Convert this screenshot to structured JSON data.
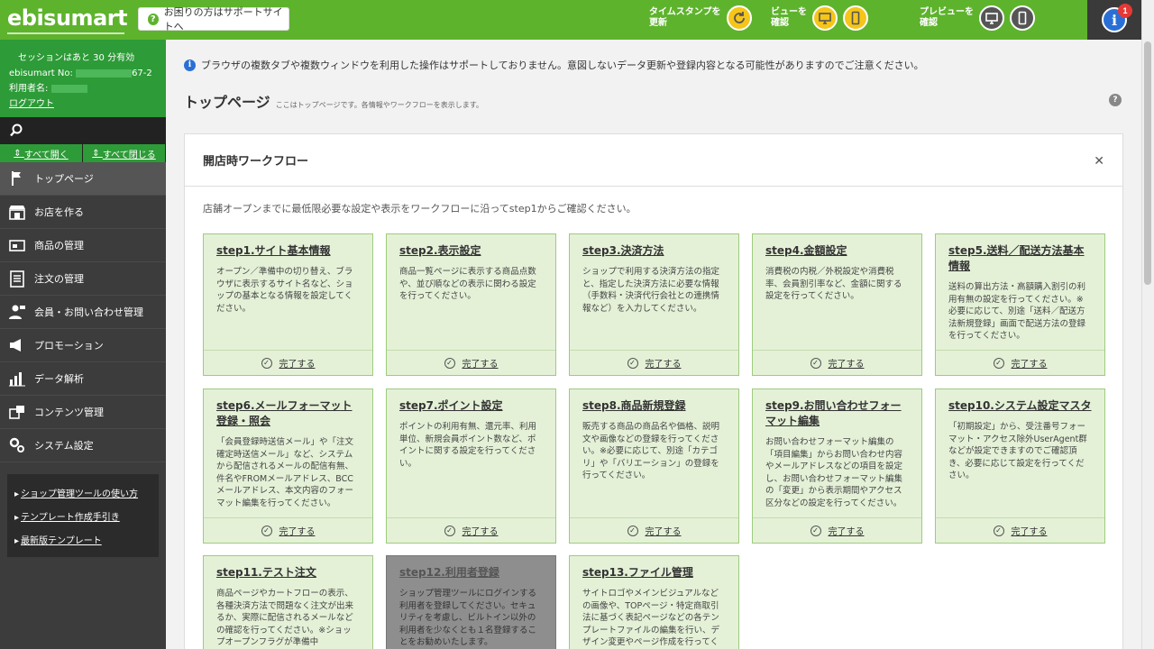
{
  "header": {
    "logo": "ebisumart",
    "support_label": "お困りの方はサポートサイトへ",
    "timestamp_label_1": "タイムスタンプを",
    "timestamp_label_2": "更新",
    "view_label_1": "ビューを",
    "view_label_2": "確認",
    "preview_label_1": "プレビューを",
    "preview_label_2": "確認",
    "info_badge": "1"
  },
  "sidebar": {
    "session_text": "セッションはあと 30 分有効",
    "store_no_label": "ebisumart No:",
    "store_no_suffix": "67-2",
    "user_label": "利用者名:",
    "logout": "ログアウト",
    "open_all": "すべて開く",
    "close_all": "すべて閉じる",
    "items": [
      {
        "label": "トップページ"
      },
      {
        "label": "お店を作る"
      },
      {
        "label": "商品の管理"
      },
      {
        "label": "注文の管理"
      },
      {
        "label": "会員・お問い合わせ管理"
      },
      {
        "label": "プロモーション"
      },
      {
        "label": "データ解析"
      },
      {
        "label": "コンテンツ管理"
      },
      {
        "label": "システム設定"
      }
    ],
    "links": [
      "ショップ管理ツールの使い方",
      "テンプレート作成手引き",
      "最新版テンプレート"
    ]
  },
  "main": {
    "notice": "ブラウザの複数タブや複数ウィンドウを利用した操作はサポートしておりません。意図しないデータ更新や登録内容となる可能性がありますのでご注意ください。",
    "title": "トップページ",
    "subtitle": "ここはトップページです。各情報やワークフローを表示します。",
    "panel_title": "開店時ワークフロー",
    "intro": "店舗オープンまでに最低限必要な設定や表示をワークフローに沿ってstep1からご確認ください。",
    "complete_label": "完了する",
    "steps": [
      {
        "title": "step1.サイト基本情報",
        "desc": "オープン／準備中の切り替え、ブラウザに表示するサイト名など、ショップの基本となる情報を設定してください。"
      },
      {
        "title": "step2.表示設定",
        "desc": "商品一覧ページに表示する商品点数や、並び順などの表示に関わる設定を行ってください。"
      },
      {
        "title": "step3.決済方法",
        "desc": "ショップで利用する決済方法の指定と、指定した決済方法に必要な情報（手数料・決済代行会社との連携情報など）を入力してください。"
      },
      {
        "title": "step4.金額設定",
        "desc": "消費税の内税／外税設定や消費税率、会員割引率など、金額に関する設定を行ってください。"
      },
      {
        "title": "step5.送料／配送方法基本情報",
        "desc": "送料の算出方法・高額購入割引の利用有無の設定を行ってください。※必要に応じて、別途「送料／配送方法新規登録」画面で配送方法の登録を行ってください。"
      },
      {
        "title": "step6.メールフォーマット登録・照会",
        "desc": "「会員登録時送信メール」や「注文確定時送信メール」など、システムから配信されるメールの配信有無、件名やFROMメールアドレス、BCCメールアドレス、本文内容のフォーマット編集を行ってください。"
      },
      {
        "title": "step7.ポイント設定",
        "desc": "ポイントの利用有無、還元率、利用単位、新規会員ポイント数など、ポイントに関する設定を行ってください。"
      },
      {
        "title": "step8.商品新規登録",
        "desc": "販売する商品の商品名や価格、説明文や画像などの登録を行ってください。※必要に応じて、別途「カテゴリ」や「バリエーション」の登録を行ってください。"
      },
      {
        "title": "step9.お問い合わせフォーマット編集",
        "desc": "お問い合わせフォーマット編集の「項目編集」からお問い合わせ内容やメールアドレスなどの項目を設定し、お問い合わせフォーマット編集の「変更」から表示期間やアクセス区分などの設定を行ってください。"
      },
      {
        "title": "step10.システム設定マスタ",
        "desc": "「初期設定」から、受注番号フォーマット・アクセス除外UserAgent群などが設定できますのでご確認頂き、必要に応じて設定を行ってください。"
      },
      {
        "title": "step11.テスト注文",
        "desc": "商品ページやカートフローの表示、各種決済方法で問題なく注文が出来るか、実際に配信されるメールなどの確認を行ってください。※ショップオープンフラグが準備中"
      },
      {
        "title": "step12.利用者登録",
        "desc": "ショップ管理ツールにログインする利用者を登録してください。セキュリティを考慮し、ビルトイン以外の利用者を少なくとも１名登録することをお勧めいたします。"
      },
      {
        "title": "step13.ファイル管理",
        "desc": "サイトロゴやメインビジュアルなどの画像や、TOPページ・特定商取引法に基づく表記ページなどの各テンプレートファイルの編集を行い、デザイン変更やページ作成を行ってく"
      }
    ]
  }
}
